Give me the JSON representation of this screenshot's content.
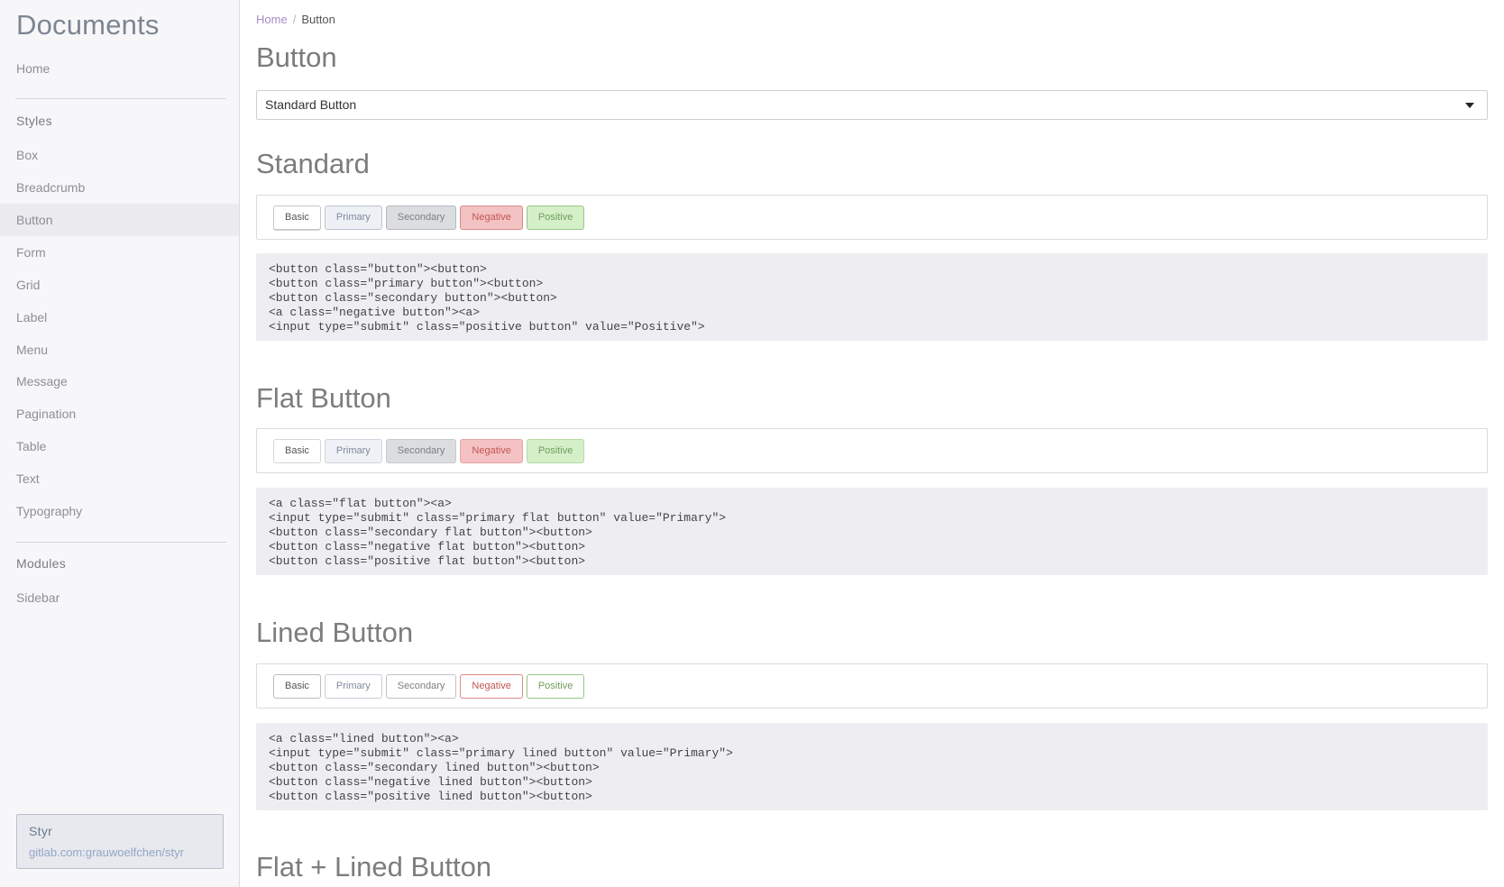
{
  "sidebar": {
    "brand": "Documents",
    "home": "Home",
    "styles_heading": "Styles",
    "style_items": [
      "Box",
      "Breadcrumb",
      "Button",
      "Form",
      "Grid",
      "Label",
      "Menu",
      "Message",
      "Pagination",
      "Table",
      "Text",
      "Typography"
    ],
    "active_item": "Button",
    "modules_heading": "Modules",
    "module_items": [
      "Sidebar"
    ],
    "repo": {
      "title": "Styr",
      "link": "gitlab.com:grauwoelfchen/styr"
    }
  },
  "breadcrumb": {
    "home": "Home",
    "separator": "/",
    "current": "Button"
  },
  "page": {
    "title": "Button",
    "select_value": "Standard Button"
  },
  "buttons": [
    "Basic",
    "Primary",
    "Secondary",
    "Negative",
    "Positive"
  ],
  "sections": [
    {
      "title": "Standard",
      "code": [
        "<button class=\"button\"><button>",
        "<button class=\"primary button\"><button>",
        "<button class=\"secondary button\"><button>",
        "<a class=\"negative button\"><a>",
        "<input type=\"submit\" class=\"positive button\" value=\"Positive\">"
      ]
    },
    {
      "title": "Flat Button",
      "code": [
        "<a class=\"flat button\"><a>",
        "<input type=\"submit\" class=\"primary flat button\" value=\"Primary\">",
        "<button class=\"secondary flat button\"><button>",
        "<button class=\"negative flat button\"><button>",
        "<button class=\"positive flat button\"><button>"
      ]
    },
    {
      "title": "Lined Button",
      "code": [
        "<a class=\"lined button\"><a>",
        "<input type=\"submit\" class=\"primary lined button\" value=\"Primary\">",
        "<button class=\"secondary lined button\"><button>",
        "<button class=\"negative lined button\"><button>",
        "<button class=\"positive lined button\"><button>"
      ]
    },
    {
      "title": "Flat + Lined Button"
    }
  ],
  "colors": {
    "sidebar_bg": "#f7f7f9",
    "active_item_bg": "#ececf0",
    "code_bg": "#eeeef2",
    "negative": "#c25555",
    "positive": "#6f9e5c",
    "breadcrumb_link": "#a98bc6"
  }
}
